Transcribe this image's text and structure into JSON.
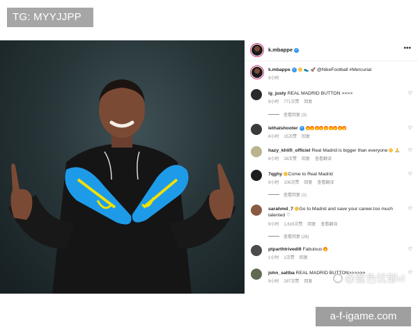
{
  "tag": "TG: MYYJJPP",
  "site": "a-f-igame.com",
  "watermark": "@藍色忧郁vi",
  "post": {
    "author": "k.mbappe",
    "caption": {
      "user": "k.mbappe",
      "text": "@NikeFootball #Mercurial",
      "time": "9小时"
    }
  },
  "comments": [
    {
      "user": "ig_justy",
      "text": "REAL MADRID BUTTON >>>>",
      "time": "9小时",
      "likes": "771次赞",
      "reply": "回复",
      "replies": "查看回复 (3)"
    },
    {
      "user": "lethalshooter",
      "verified": true,
      "text": "",
      "time": "8小时",
      "likes": "15次赞",
      "reply": "回复"
    },
    {
      "user": "hazy_khlifi_officiel",
      "text": "Real Madrid is bigger than everyone",
      "time": "8小时",
      "likes": "28次赞",
      "reply": "回复",
      "translate": "查看翻译"
    },
    {
      "user": "7qghy",
      "text": "Come to Real Madrid",
      "time": "9小时",
      "likes": "106次赞",
      "reply": "回复",
      "translate": "查看翻译",
      "replies": "查看回复 (1)"
    },
    {
      "user": "sarahmd_7",
      "text": "Go to Madrid and save your career.too much talented",
      "time": "9小时",
      "likes": "1,616次赞",
      "reply": "回复",
      "translate": "查看翻译",
      "replies": "查看回复 (28)"
    },
    {
      "user": "ptparthtrivedi9",
      "text": "Fabulous",
      "time": "1小时",
      "likes": "1次赞",
      "reply": "回复"
    },
    {
      "user": "john_saltba",
      "text": "REAL MADRID BUTTON>>>>>>",
      "time": "9小时",
      "likes": "297次赞",
      "reply": "回复"
    }
  ],
  "colors": {
    "verified": "#3897f0",
    "meta": "#8e8e8e",
    "boot": "#1e9be8",
    "boot_accent": "#f2e000"
  }
}
